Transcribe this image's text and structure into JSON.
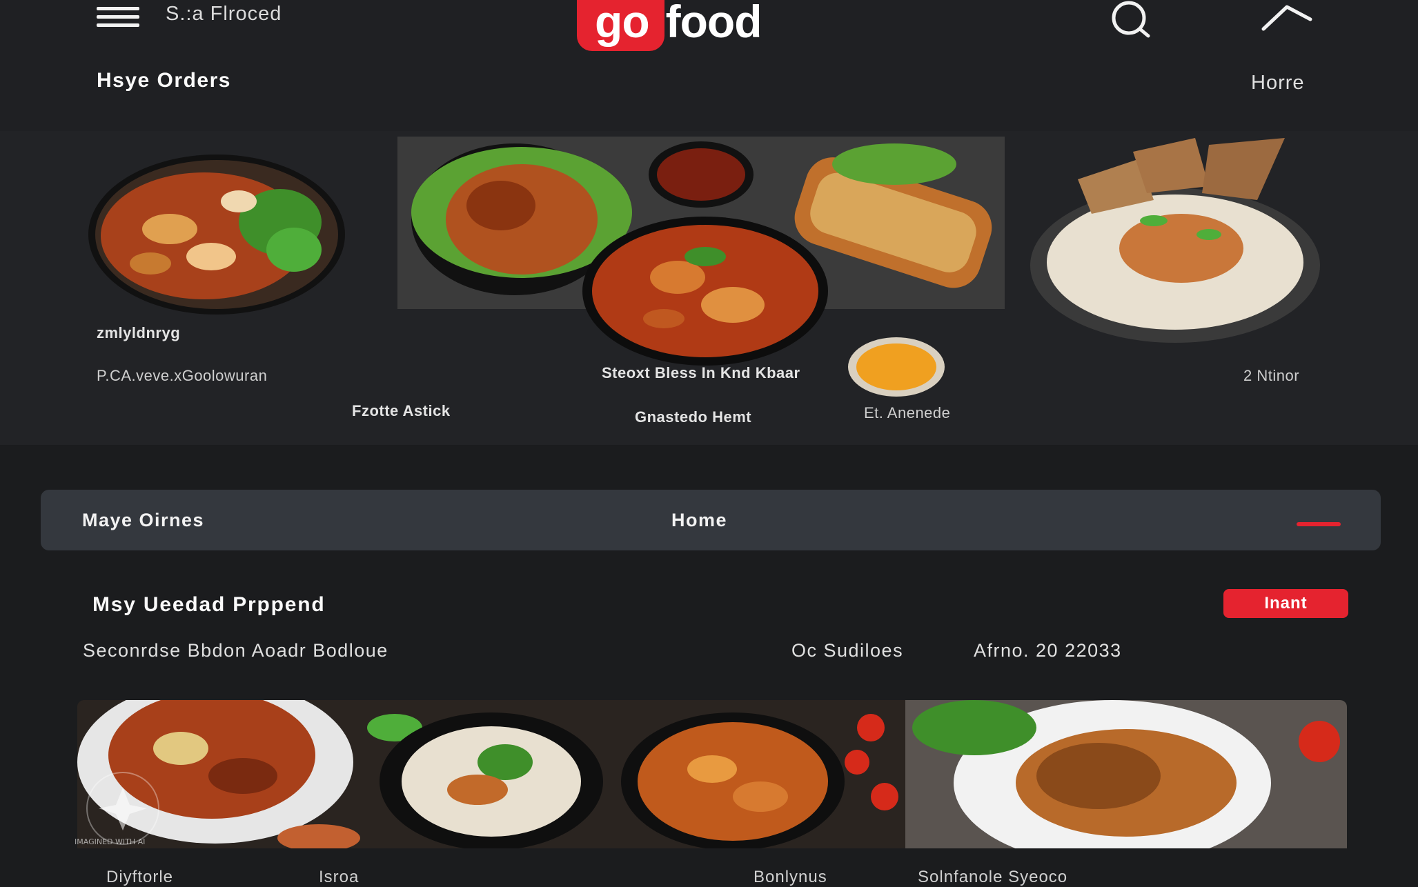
{
  "header": {
    "brand_sub": "S.:a Flroced",
    "logo_red": "go",
    "logo_white": "food",
    "icons": {
      "menu": "menu-icon",
      "search": "search-icon",
      "collapse": "chevron-up-icon"
    }
  },
  "orders_row": {
    "title": "Hsye Orders",
    "link": "Horre"
  },
  "food_strip": {
    "captions": [
      "zmlyldnryg",
      "P.CA.veve.xGoolowuran",
      "Fzotte Astick",
      "Steoxt Bless In Knd Kbaar",
      "Gnastedo Hemt",
      "Et. Anenede",
      "2 Ntinor"
    ]
  },
  "tabs": {
    "items": [
      {
        "label": "Maye Oirnes"
      },
      {
        "label": "Home"
      }
    ],
    "accent": "#e5232f"
  },
  "order": {
    "title": "Msy Ueedad Prppend",
    "status": "Inant",
    "description": "Seconrdse Bbdon Aoadr Bodloue",
    "meta": "Oc Sudiloes",
    "date": "Afrno. 20 22033"
  },
  "gallery": {
    "captions": [
      "Diyftorle",
      "Isroa",
      "Bonlynus",
      "Solnfanole Syeoco"
    ]
  },
  "watermark": {
    "text": "IMAGINED WITH AI"
  },
  "colors": {
    "background": "#1b1c1e",
    "accent": "#e5232f",
    "tabbar": "#34383e"
  }
}
